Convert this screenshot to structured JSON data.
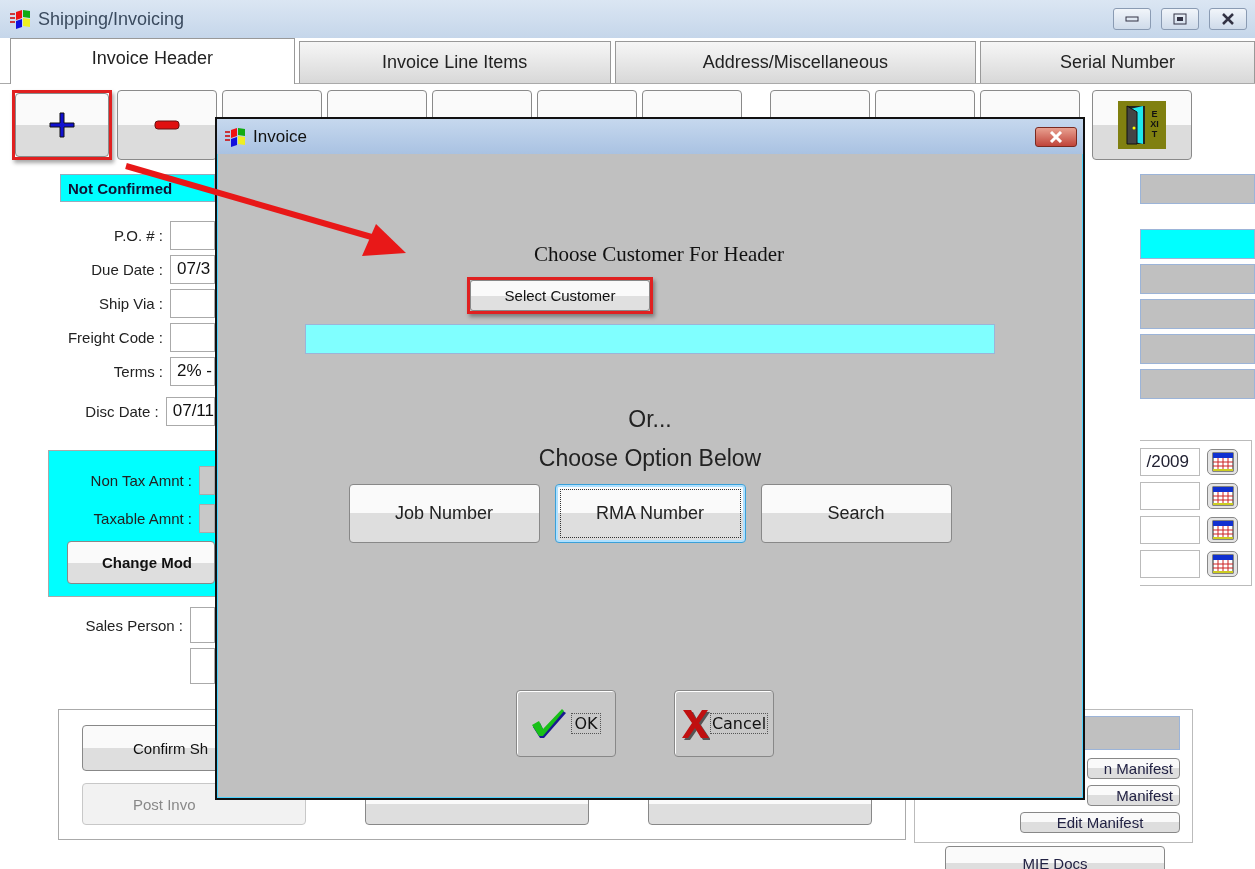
{
  "window": {
    "title": "Shipping/Invoicing"
  },
  "tabs": [
    {
      "label": "Invoice Header",
      "selected": true
    },
    {
      "label": "Invoice Line Items",
      "selected": false
    },
    {
      "label": "Address/Miscellaneous",
      "selected": false
    },
    {
      "label": "Serial Number",
      "selected": false
    }
  ],
  "toolbar": [
    {
      "kind": "add",
      "highlighted": true
    },
    {
      "kind": "remove",
      "highlighted": false
    },
    {
      "kind": "other",
      "highlighted": false
    },
    {
      "kind": "other",
      "highlighted": false
    },
    {
      "kind": "other",
      "highlighted": false
    },
    {
      "kind": "other",
      "highlighted": false
    },
    {
      "kind": "other",
      "highlighted": false
    },
    {
      "kind": "other",
      "highlighted": false
    },
    {
      "kind": "other",
      "highlighted": false
    },
    {
      "kind": "other",
      "highlighted": false
    },
    {
      "kind": "exit",
      "label": "EXIT",
      "highlighted": false
    }
  ],
  "status": "Not Confirmed",
  "form": [
    {
      "label": "P.O. # :"
    },
    {
      "label": "Due Date :",
      "value": "07/3"
    },
    {
      "label": "Ship Via :"
    },
    {
      "label": "Freight Code :"
    },
    {
      "label": "Terms :",
      "value": "2% -"
    },
    {
      "label": "Disc Date :",
      "value": "07/11"
    }
  ],
  "amounts": {
    "fields": [
      {
        "label": "Non Tax Amnt :"
      },
      {
        "label": "Taxable Amnt :"
      }
    ],
    "button": "Change Mod"
  },
  "sales_person": {
    "label": "Sales Person :"
  },
  "info_fields": [
    {
      "highlighted": false
    },
    {
      "highlighted": true
    },
    {
      "highlighted": false
    },
    {
      "highlighted": false
    },
    {
      "highlighted": false
    },
    {
      "highlighted": false
    }
  ],
  "date_fields": [
    {
      "kind": "filled",
      "value": "/2009"
    },
    {
      "kind": "empty"
    },
    {
      "kind": "empty"
    },
    {
      "kind": "empty"
    }
  ],
  "actions": [
    {
      "label": "Confirm Sh",
      "disabled": false
    },
    {
      "label": "Post Invo",
      "disabled": true
    }
  ],
  "manifest_buttons": [
    "n Manifest",
    "Manifest",
    "Edit Manifest"
  ],
  "mie_docs": "MIE Docs",
  "dialog": {
    "title": "Invoice",
    "prompt": "Choose Customer For Header",
    "select_button": {
      "label": "Select Customer",
      "highlighted": true
    },
    "or": "Or...",
    "option_heading": "Choose Option Below",
    "options": [
      {
        "label": "Job Number",
        "focused": false
      },
      {
        "label": "RMA Number",
        "focused": true
      },
      {
        "label": "Search",
        "focused": false
      }
    ],
    "ok": "OK",
    "cancel": "Cancel"
  }
}
